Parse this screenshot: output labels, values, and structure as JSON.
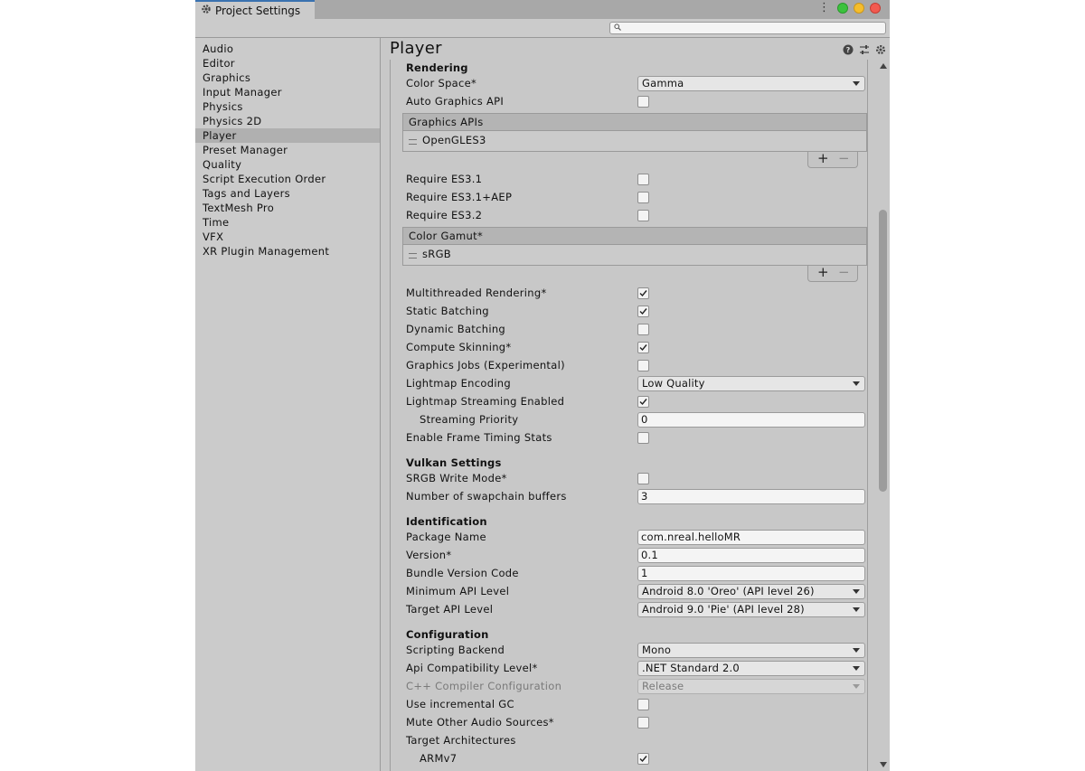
{
  "window": {
    "tab_title": "Project Settings"
  },
  "search": {
    "placeholder": ""
  },
  "sidebar": {
    "items": [
      {
        "label": "Audio"
      },
      {
        "label": "Editor"
      },
      {
        "label": "Graphics"
      },
      {
        "label": "Input Manager"
      },
      {
        "label": "Physics"
      },
      {
        "label": "Physics 2D"
      },
      {
        "label": "Player"
      },
      {
        "label": "Preset Manager"
      },
      {
        "label": "Quality"
      },
      {
        "label": "Script Execution Order"
      },
      {
        "label": "Tags and Layers"
      },
      {
        "label": "TextMesh Pro"
      },
      {
        "label": "Time"
      },
      {
        "label": "VFX"
      },
      {
        "label": "XR Plugin Management"
      }
    ],
    "active": "Player"
  },
  "main": {
    "title": "Player",
    "sections": {
      "rendering": "Rendering",
      "vulkan": "Vulkan Settings",
      "identification": "Identification",
      "configuration": "Configuration"
    },
    "rendering": {
      "color_space": {
        "label": "Color Space*",
        "value": "Gamma"
      },
      "auto_graphics_api": {
        "label": "Auto Graphics API",
        "checked": false
      },
      "graphics_apis": {
        "header": "Graphics APIs",
        "items": [
          "OpenGLES3"
        ]
      },
      "require_es31": {
        "label": "Require ES3.1",
        "checked": false
      },
      "require_es31_aep": {
        "label": "Require ES3.1+AEP",
        "checked": false
      },
      "require_es32": {
        "label": "Require ES3.2",
        "checked": false
      },
      "color_gamut": {
        "header": "Color Gamut*",
        "items": [
          "sRGB"
        ]
      },
      "multithreaded_rendering": {
        "label": "Multithreaded Rendering*",
        "checked": true
      },
      "static_batching": {
        "label": "Static Batching",
        "checked": true
      },
      "dynamic_batching": {
        "label": "Dynamic Batching",
        "checked": false
      },
      "compute_skinning": {
        "label": "Compute Skinning*",
        "checked": true
      },
      "graphics_jobs": {
        "label": "Graphics Jobs (Experimental)",
        "checked": false
      },
      "lightmap_encoding": {
        "label": "Lightmap Encoding",
        "value": "Low Quality"
      },
      "lightmap_streaming": {
        "label": "Lightmap Streaming Enabled",
        "checked": true
      },
      "streaming_priority": {
        "label": "Streaming Priority",
        "value": "0"
      },
      "frame_timing_stats": {
        "label": "Enable Frame Timing Stats",
        "checked": false
      }
    },
    "vulkan": {
      "srgb_write_mode": {
        "label": "SRGB Write Mode*",
        "checked": false
      },
      "swapchain_buffers": {
        "label": "Number of swapchain buffers",
        "value": "3"
      }
    },
    "identification": {
      "package_name": {
        "label": "Package Name",
        "value": "com.nreal.helloMR"
      },
      "version": {
        "label": "Version*",
        "value": "0.1"
      },
      "bundle_version_code": {
        "label": "Bundle Version Code",
        "value": "1"
      },
      "min_api_level": {
        "label": "Minimum API Level",
        "value": "Android 8.0 'Oreo' (API level 26)"
      },
      "target_api_level": {
        "label": "Target API Level",
        "value": "Android 9.0 'Pie' (API level 28)"
      }
    },
    "configuration": {
      "scripting_backend": {
        "label": "Scripting Backend",
        "value": "Mono"
      },
      "api_compat": {
        "label": "Api Compatibility Level*",
        "value": ".NET Standard 2.0"
      },
      "cpp_compiler": {
        "label": "C++ Compiler Configuration",
        "value": "Release"
      },
      "incremental_gc": {
        "label": "Use incremental GC",
        "checked": false
      },
      "mute_audio": {
        "label": "Mute Other Audio Sources*",
        "checked": false
      },
      "target_arch": {
        "label": "Target Architectures"
      },
      "armv7": {
        "label": "ARMv7",
        "checked": true
      }
    }
  },
  "colors": {
    "accent_tab": "#3a72b0",
    "active_item": "#b0b0b0"
  }
}
